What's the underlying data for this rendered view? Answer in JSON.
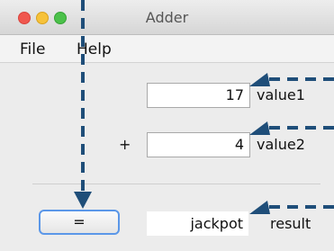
{
  "window": {
    "title": "Adder"
  },
  "menu": {
    "items": [
      "File",
      "Help"
    ]
  },
  "form": {
    "value1": {
      "value": "17",
      "label": "value1"
    },
    "value2": {
      "value": "4",
      "label": "value2"
    },
    "operator": "+",
    "button_label": "=",
    "result": {
      "value": "jackpot",
      "label": "result"
    }
  },
  "colors": {
    "arrow": "#1f4e79",
    "focus_ring": "#5b97e8",
    "close": "#f0574f",
    "minimize": "#f6c23a",
    "zoom": "#4bc14a"
  }
}
